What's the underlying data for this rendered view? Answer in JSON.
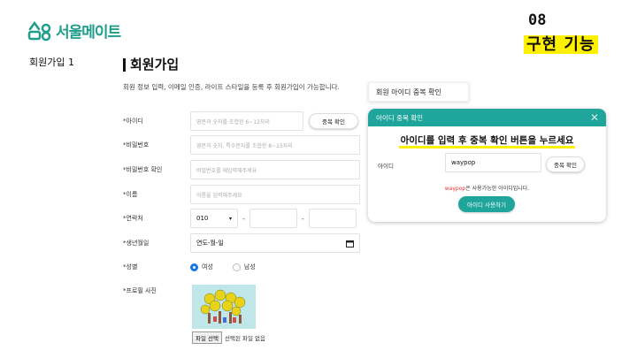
{
  "brand": {
    "name": "서울메이트",
    "color": "#1f9e8a"
  },
  "slide": {
    "label": "회원가입 1",
    "number": "08",
    "title": "구현 기능",
    "highlight": "#fff000"
  },
  "page": {
    "title": "회원가입",
    "description": "회원 정보 입력, 이메일 인증, 라이프 스타일을 등록 후 회원가입이 가능합니다."
  },
  "form": {
    "id": {
      "label": "*아이디",
      "placeholder": "영문과 숫자를 조합한 6~12자리",
      "check_button": "중복 확인"
    },
    "password": {
      "label": "*비밀번호",
      "placeholder": "영문과 숫자, 특수문자를 조합한 8~15자리"
    },
    "password_confirm": {
      "label": "*비밀번호 확인",
      "placeholder": "비밀번호를 재입력해주세요"
    },
    "name": {
      "label": "*이름",
      "placeholder": "이름을 입력해주세요"
    },
    "phone": {
      "label": "*연락처",
      "prefix": "010",
      "dropdown_icon": "▾",
      "dash": "-"
    },
    "birthdate": {
      "label": "*생년월일",
      "value": "연도-월-일",
      "icon": "calendar-icon"
    },
    "gender": {
      "label": "*성별",
      "options": [
        "여성",
        "남성"
      ],
      "selected": "여성"
    },
    "photo": {
      "label": "*프로필 사진",
      "file_button": "파일 선택",
      "file_status": "선택된 파일 없음"
    }
  },
  "tooltip": {
    "text": "회원 아이디 중복 확인"
  },
  "modal": {
    "title": "아이디 중복 확인",
    "close": "✕",
    "instruction": "아이디를 입력 후 중복 확인 버튼을 누르세요",
    "field_label": "아이디",
    "field_value": "waypop",
    "check_button": "중복 확인",
    "result_id": "waypop",
    "result_text": "은 사용가능한 아이디입니다.",
    "use_button": "아이디 사용하기",
    "accent": "#1fa59c"
  }
}
